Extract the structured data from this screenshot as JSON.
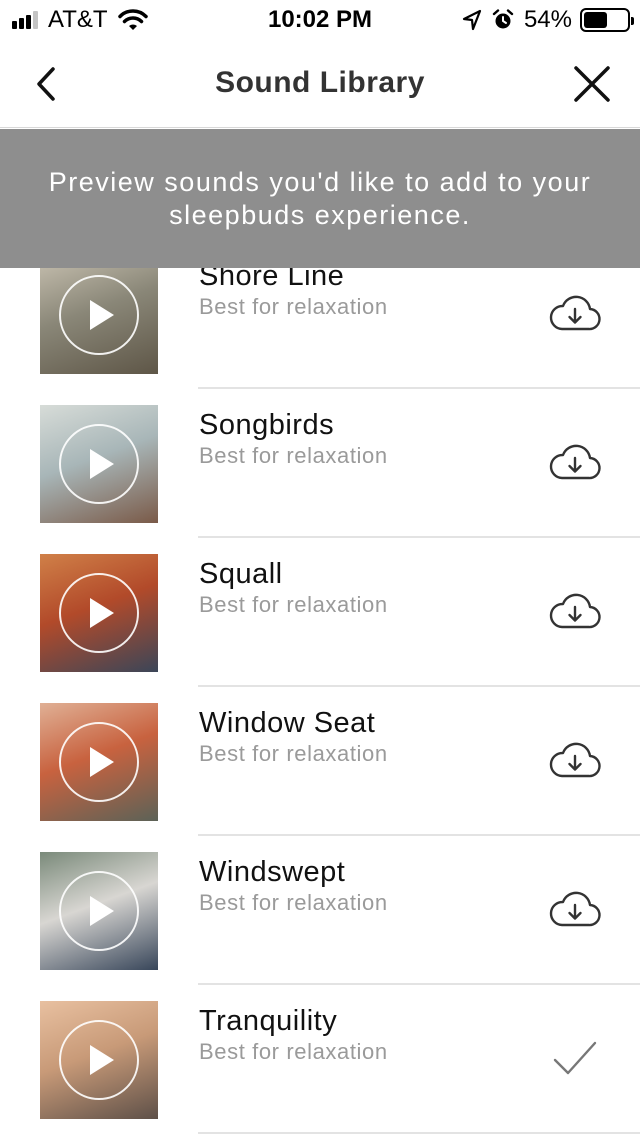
{
  "status_bar": {
    "carrier": "AT&T",
    "time": "10:02 PM",
    "battery_percent": "54%",
    "battery_level": 0.54,
    "signal_bars_on": 3,
    "icons": [
      "signal-icon",
      "wifi-icon",
      "location-icon",
      "alarm-icon",
      "battery-icon"
    ]
  },
  "nav": {
    "title": "Sound Library",
    "back_icon": "chevron-left-icon",
    "close_icon": "close-icon"
  },
  "banner": {
    "text": "Preview sounds you'd like to add to your sleepbuds experience."
  },
  "sounds": [
    {
      "title": "Shore Line",
      "subtitle": "Best for relaxation",
      "status": "download",
      "action_icon": "cloud-download-icon",
      "colors": [
        "#8a8778",
        "#5e5647",
        "#c7c0b0"
      ]
    },
    {
      "title": "Songbirds",
      "subtitle": "Best for relaxation",
      "status": "download",
      "action_icon": "cloud-download-icon",
      "colors": [
        "#a8b6b8",
        "#7a5a48",
        "#d7dcd8"
      ]
    },
    {
      "title": "Squall",
      "subtitle": "Best for relaxation",
      "status": "download",
      "action_icon": "cloud-download-icon",
      "colors": [
        "#b24a2a",
        "#3b4658",
        "#d08048"
      ]
    },
    {
      "title": "Window Seat",
      "subtitle": "Best for relaxation",
      "status": "download",
      "action_icon": "cloud-download-icon",
      "colors": [
        "#c8623f",
        "#5c6257",
        "#e0b095"
      ]
    },
    {
      "title": "Windswept",
      "subtitle": "Best for relaxation",
      "status": "download",
      "action_icon": "cloud-download-icon",
      "colors": [
        "#d8d6d2",
        "#38465a",
        "#7a8a7a"
      ]
    },
    {
      "title": "Tranquility",
      "subtitle": "Best for relaxation",
      "status": "added",
      "action_icon": "checkmark-icon",
      "colors": [
        "#c89a78",
        "#5e5048",
        "#e8c0a0"
      ]
    }
  ]
}
